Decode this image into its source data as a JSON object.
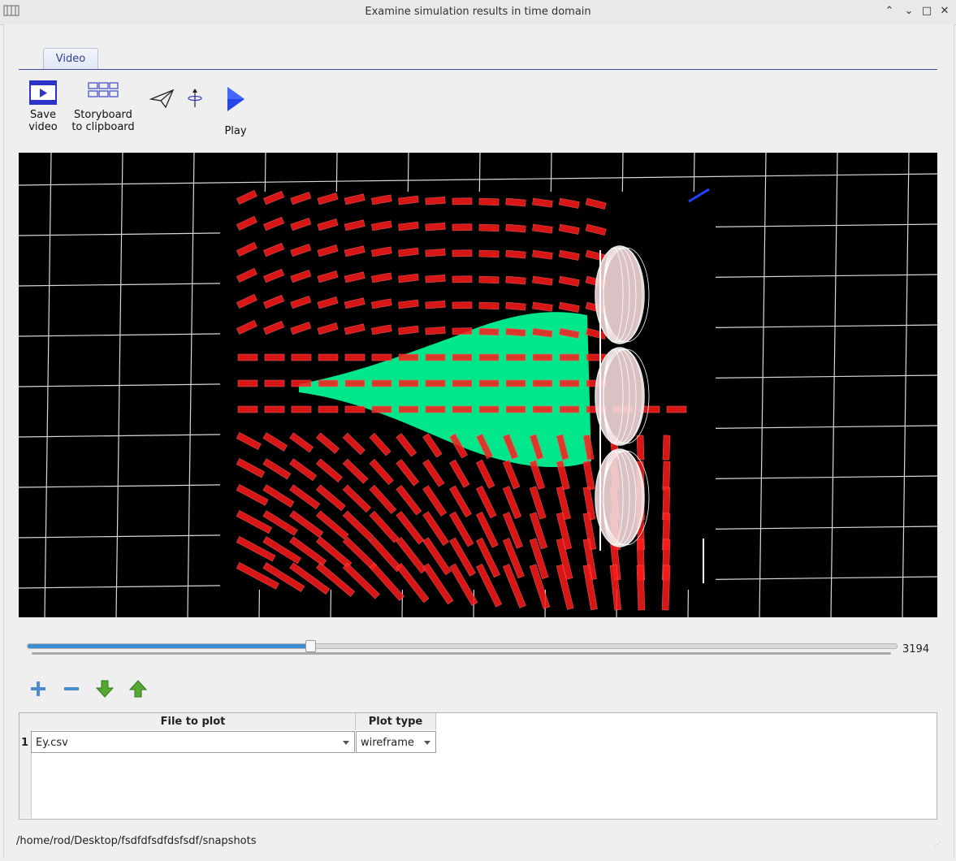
{
  "window": {
    "title": "Examine simulation results in time domain",
    "controls": [
      "⌃",
      "⌄",
      "□",
      "✕"
    ]
  },
  "tabs": [
    {
      "label": "Video",
      "active": true
    }
  ],
  "toolbar": {
    "save_video": {
      "line1": "Save",
      "line2": "video",
      "icon": "film-icon"
    },
    "storyboard": {
      "line1": "Storyboard",
      "line2": "to clipboard",
      "icon": "storyboard-icon"
    },
    "send_icon": "paper-plane-icon",
    "rotate_icon": "rotate-axis-icon",
    "play": {
      "label": "Play",
      "icon": "play-icon"
    }
  },
  "viewport": {
    "description_icon": "3d-render",
    "colors": {
      "vectors": "#ff1a1a",
      "field": "#00ff99",
      "mesh": "#ffffff",
      "background": "#000000"
    }
  },
  "timeline": {
    "value": "3194",
    "fraction": 0.325
  },
  "list_buttons": [
    "add-icon",
    "remove-icon",
    "move-down-icon",
    "move-up-icon"
  ],
  "table": {
    "headers": {
      "file": "File to plot",
      "type": "Plot type"
    },
    "rows": [
      {
        "index": "1",
        "file": "Ey.csv",
        "type": "wireframe"
      }
    ]
  },
  "status": {
    "path": "/home/rod/Desktop/fsdfdfsdfdsfsdf/snapshots"
  }
}
